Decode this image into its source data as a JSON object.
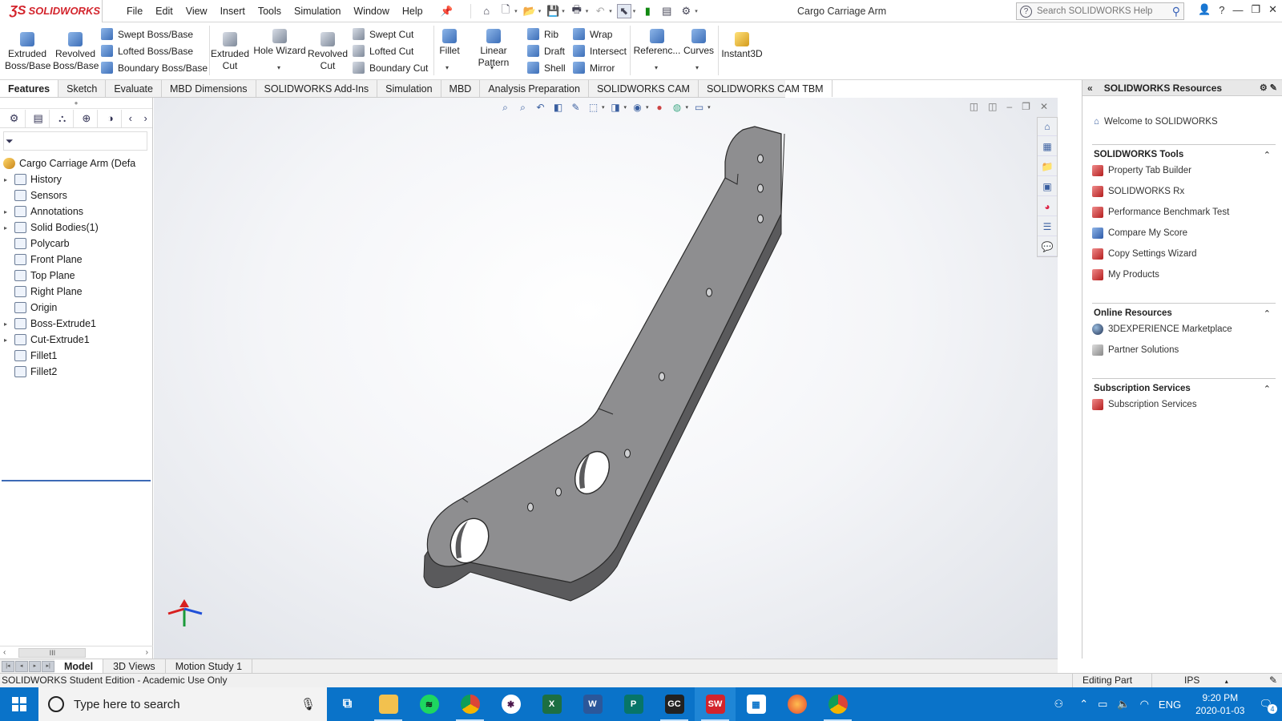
{
  "app": {
    "logo_ds": "ƷS",
    "logo_text": "SOLIDWORKS",
    "doc_title": "Cargo Carriage Arm",
    "search_placeholder": "Search SOLIDWORKS Help",
    "accent_color": "#d3242c"
  },
  "menu": [
    "File",
    "Edit",
    "View",
    "Insert",
    "Tools",
    "Simulation",
    "Window",
    "Help"
  ],
  "command_manager": {
    "extruded_boss": "Extruded Boss/Base",
    "revolved_boss": "Revolved Boss/Base",
    "swept_boss": "Swept Boss/Base",
    "lofted_boss": "Lofted Boss/Base",
    "boundary_boss": "Boundary Boss/Base",
    "extruded_cut": "Extruded Cut",
    "hole_wizard": "Hole Wizard",
    "revolved_cut": "Revolved Cut",
    "swept_cut": "Swept Cut",
    "lofted_cut": "Lofted Cut",
    "boundary_cut": "Boundary Cut",
    "fillet": "Fillet",
    "linear_pattern": "Linear Pattern",
    "rib": "Rib",
    "draft": "Draft",
    "shell": "Shell",
    "wrap": "Wrap",
    "intersect": "Intersect",
    "mirror": "Mirror",
    "reference": "Referenc...",
    "curves": "Curves",
    "instant3d": "Instant3D"
  },
  "tabs": [
    "Features",
    "Sketch",
    "Evaluate",
    "MBD Dimensions",
    "SOLIDWORKS Add-Ins",
    "Simulation",
    "MBD",
    "Analysis Preparation",
    "SOLIDWORKS CAM",
    "SOLIDWORKS CAM TBM"
  ],
  "tree": {
    "root": "Cargo Carriage Arm  (Defa",
    "items": [
      {
        "label": "History",
        "expandable": true
      },
      {
        "label": "Sensors",
        "expandable": false
      },
      {
        "label": "Annotations",
        "expandable": true
      },
      {
        "label": "Solid Bodies(1)",
        "expandable": true
      },
      {
        "label": "Polycarb",
        "expandable": false
      },
      {
        "label": "Front Plane",
        "expandable": false
      },
      {
        "label": "Top Plane",
        "expandable": false
      },
      {
        "label": "Right Plane",
        "expandable": false
      },
      {
        "label": "Origin",
        "expandable": false
      },
      {
        "label": "Boss-Extrude1",
        "expandable": true
      },
      {
        "label": "Cut-Extrude1",
        "expandable": true
      },
      {
        "label": "Fillet1",
        "expandable": false
      },
      {
        "label": "Fillet2",
        "expandable": false
      }
    ],
    "scroll_thumb": "III"
  },
  "resources": {
    "title": "SOLIDWORKS Resources",
    "welcome": "Welcome to SOLIDWORKS",
    "tools_title": "SOLIDWORKS Tools",
    "tools": [
      "Property Tab Builder",
      "SOLIDWORKS Rx",
      "Performance Benchmark Test",
      "Compare My Score",
      "Copy Settings Wizard",
      "My Products"
    ],
    "online_title": "Online Resources",
    "online": [
      "3DEXPERIENCE Marketplace",
      "Partner Solutions"
    ],
    "subs_title": "Subscription Services",
    "subs": [
      "Subscription Services"
    ]
  },
  "model_tabs": [
    "Model",
    "3D Views",
    "Motion Study 1"
  ],
  "status": {
    "left": "SOLIDWORKS Student Edition - Academic Use Only",
    "editing": "Editing Part",
    "units": "IPS"
  },
  "taskbar": {
    "search_placeholder": "Type here to search",
    "lang": "ENG",
    "time": "9:20 PM",
    "date": "2020-01-03",
    "notifications": "4"
  }
}
